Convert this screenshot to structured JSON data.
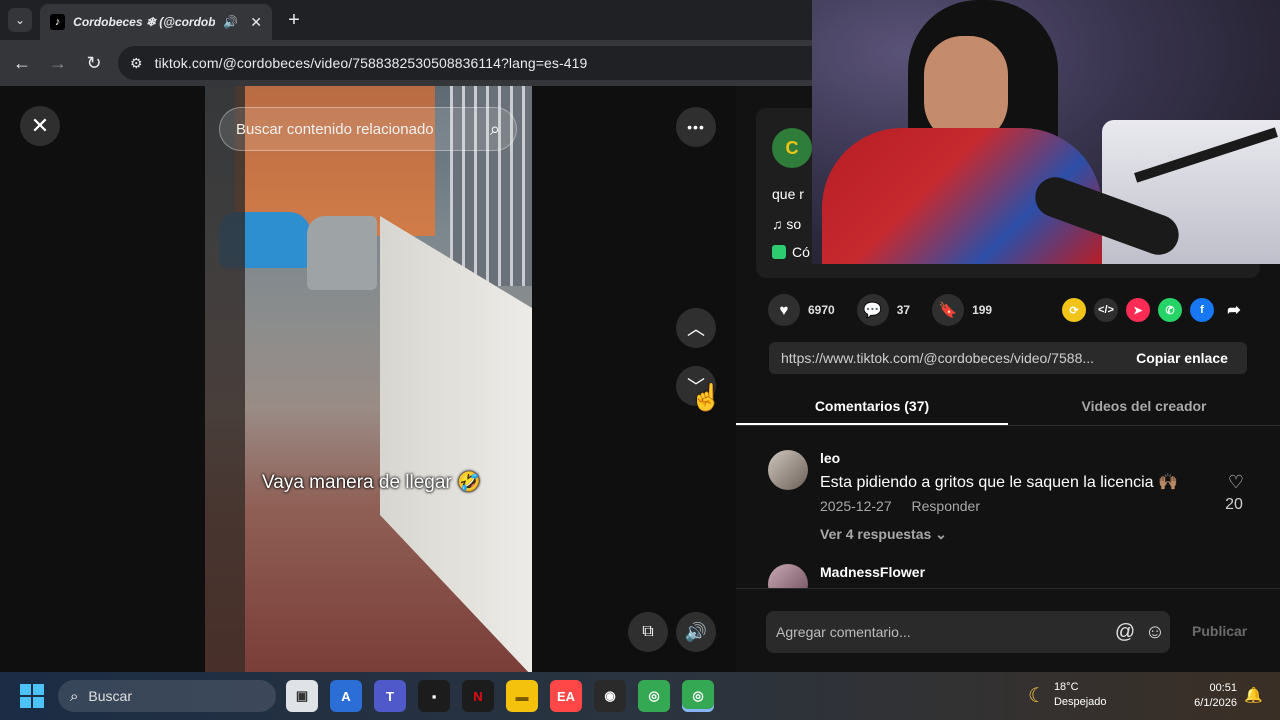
{
  "browser": {
    "tab_title": "Cordobeces ❄ (@cordobeces",
    "tab_favicon": "tiktok-icon",
    "url": "tiktok.com/@cordobeces/video/7588382530508836114?lang=es-419"
  },
  "video": {
    "search_placeholder": "Buscar contenido relacionado",
    "caption": "Vaya manera de llegar 🤣"
  },
  "info_card": {
    "avatar_letter": "C",
    "description_fragment": "que r",
    "sound_fragment": "so",
    "location_fragment": "Có"
  },
  "stats": {
    "likes": "6970",
    "comments": "37",
    "saves": "199"
  },
  "share": {
    "link": "https://www.tiktok.com/@cordobeces/video/7588...",
    "copy_label": "Copiar enlace",
    "icons": [
      "repost-icon",
      "embed-icon",
      "send-icon",
      "whatsapp-icon",
      "facebook-icon",
      "share-arrow-icon"
    ],
    "colors": [
      "#f0c419",
      "#2f2f2f",
      "#fe2c55",
      "#25d366",
      "#1877f2",
      "#121212"
    ]
  },
  "tabs": {
    "comments": "Comentarios (37)",
    "creator_videos": "Videos del creador"
  },
  "comments": [
    {
      "user": "leo",
      "text": "Esta pidiendo a gritos que le saquen la licencia 🙌🏽",
      "date": "2025-12-27",
      "reply_label": "Responder",
      "replies_label": "Ver 4 respuestas ⌄",
      "likes": "20"
    },
    {
      "user": "MadnessFlower"
    }
  ],
  "comment_bar": {
    "placeholder": "Agregar comentario...",
    "publish_label": "Publicar"
  },
  "taskbar": {
    "search_label": "Buscar",
    "temperature": "18°C",
    "weather": "Despejado",
    "time": "00:51",
    "date": "6/1/2026"
  }
}
